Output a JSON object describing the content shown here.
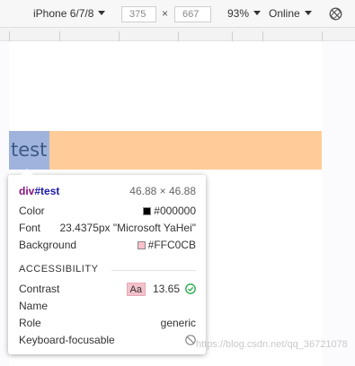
{
  "toolbar": {
    "device": "iPhone 6/7/8",
    "width": "375",
    "separator": "×",
    "height": "667",
    "zoom": "93%",
    "network": "Online"
  },
  "element": {
    "text": "test"
  },
  "tooltip": {
    "tag": "div",
    "id": "#test",
    "dimensions": "46.88 × 46.88",
    "color_label": "Color",
    "color_value": "#000000",
    "font_label": "Font",
    "font_value": "23.4375px \"Microsoft YaHei\"",
    "background_label": "Background",
    "background_value": "#FFC0CB",
    "section_title": "ACCESSIBILITY",
    "contrast_label": "Contrast",
    "contrast_badge": "Aa",
    "contrast_value": "13.65",
    "name_label": "Name",
    "name_value": "",
    "role_label": "Role",
    "role_value": "generic",
    "focus_label": "Keyboard-focusable"
  },
  "watermark": "https://blog.csdn.net/qq_36721078",
  "colors": {
    "element_fill": "#9fb3dd",
    "bar_fill": "#ffcc99",
    "color_swatch": "#000000",
    "background_swatch": "#FFC0CB",
    "tag_color": "#881280",
    "check_color": "#22a845"
  },
  "icons": {
    "rotate": "rotate-icon",
    "check": "check-icon",
    "not_focusable": "no-entry-icon"
  }
}
